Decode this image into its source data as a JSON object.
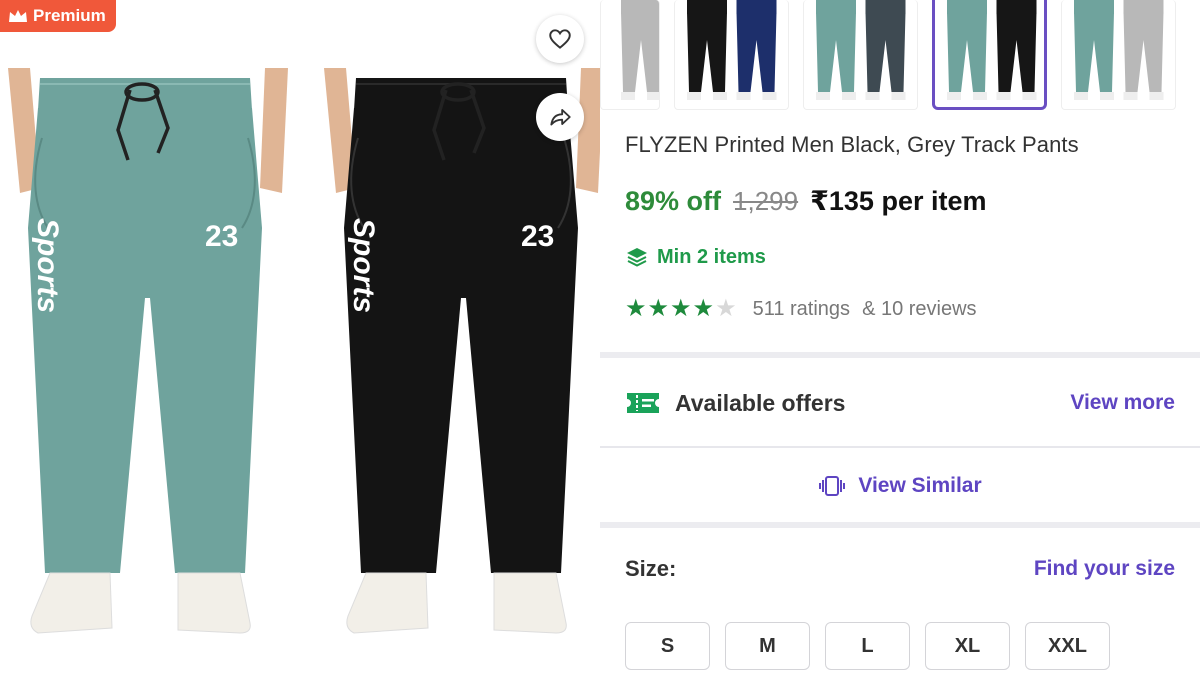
{
  "badge": {
    "label": "Premium",
    "icon": "crown-icon"
  },
  "actions": {
    "wishlist_icon": "heart-icon",
    "share_icon": "share-icon"
  },
  "gallery": {
    "pants": [
      {
        "color": "#6fa39d",
        "print_text": "Sports",
        "number": "23"
      },
      {
        "color": "#141414",
        "print_text": "Sports",
        "number": "23"
      }
    ]
  },
  "thumbnails": [
    {
      "colors": [
        "#b8b8b8"
      ],
      "selected": false
    },
    {
      "colors": [
        "#161616",
        "#1d2f6b"
      ],
      "selected": false
    },
    {
      "colors": [
        "#6fa39d",
        "#3e4a52"
      ],
      "selected": false
    },
    {
      "colors": [
        "#6fa39d",
        "#161616"
      ],
      "selected": true
    },
    {
      "colors": [
        "#6fa39d",
        "#b8b8b8"
      ],
      "selected": false
    }
  ],
  "product": {
    "title": "FLYZEN Printed Men Black, Grey Track Pants",
    "discount": "89% off",
    "mrp": "1,299",
    "price": "₹135 per item",
    "min_items": "Min 2 items",
    "rating_value": 4,
    "rating_max": 5,
    "ratings_count": "511 ratings",
    "reviews_count": "& 10 reviews"
  },
  "offers": {
    "label": "Available offers",
    "action": "View more",
    "icon": "offer-ticket-icon"
  },
  "similar": {
    "label": "View Similar",
    "icon": "similar-cards-icon"
  },
  "size": {
    "label": "Size:",
    "find_link": "Find your size",
    "options": [
      "S",
      "M",
      "L",
      "XL",
      "XXL"
    ]
  },
  "colors": {
    "accent": "#5e45c2",
    "discount_green": "#2e8b3a",
    "premium_orange": "#f0583a",
    "star_green": "#1e8a3c"
  }
}
